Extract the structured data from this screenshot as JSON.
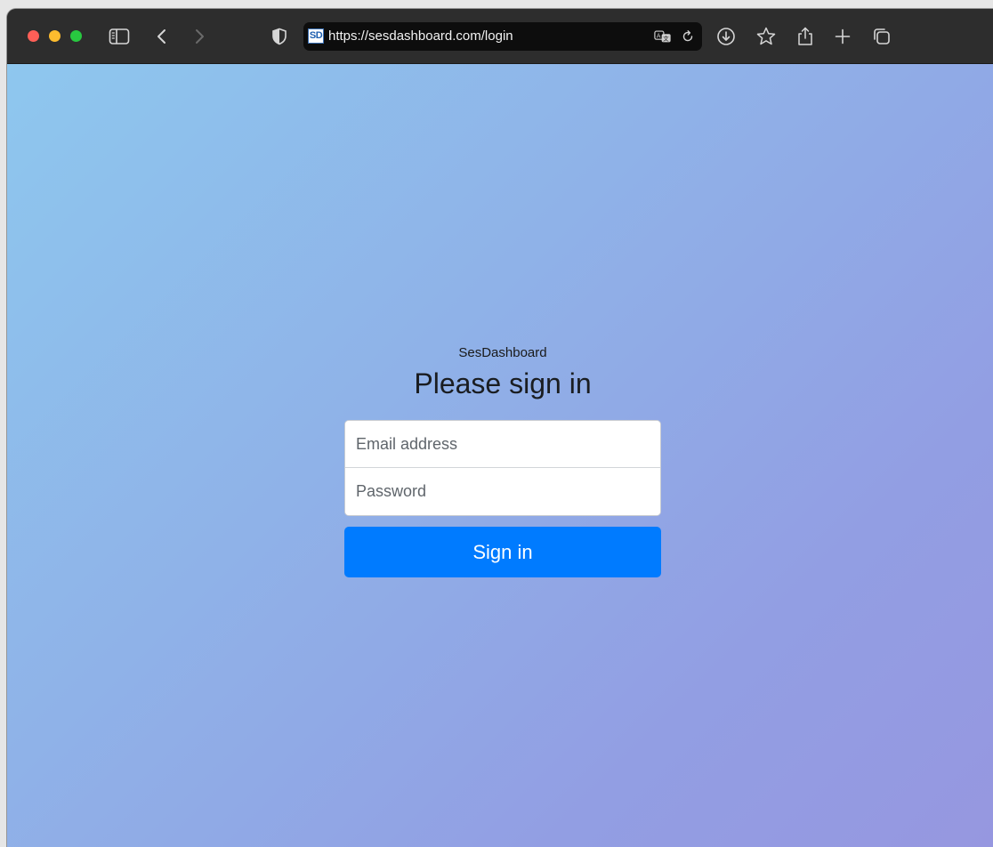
{
  "browser": {
    "url": "https://sesdashboard.com/login",
    "favicon_text": "SD",
    "icons": {
      "sidebar": "sidebar-icon",
      "back": "chevron-left-icon",
      "forward": "chevron-right-icon",
      "shield": "shield-icon",
      "translate": "translate-icon",
      "reload": "reload-icon",
      "download": "download-icon",
      "bookmark": "star-icon",
      "share": "share-icon",
      "new_tab": "plus-icon",
      "tabs": "tab-overview-icon"
    },
    "colors": {
      "close": "#ff5f57",
      "minimize": "#febc2e",
      "zoom": "#28c840"
    }
  },
  "login": {
    "brand": "SesDashboard",
    "heading": "Please sign in",
    "email_placeholder": "Email address",
    "email_value": "",
    "password_placeholder": "Password",
    "password_value": "",
    "submit_label": "Sign in",
    "accent_color": "#007bff"
  }
}
